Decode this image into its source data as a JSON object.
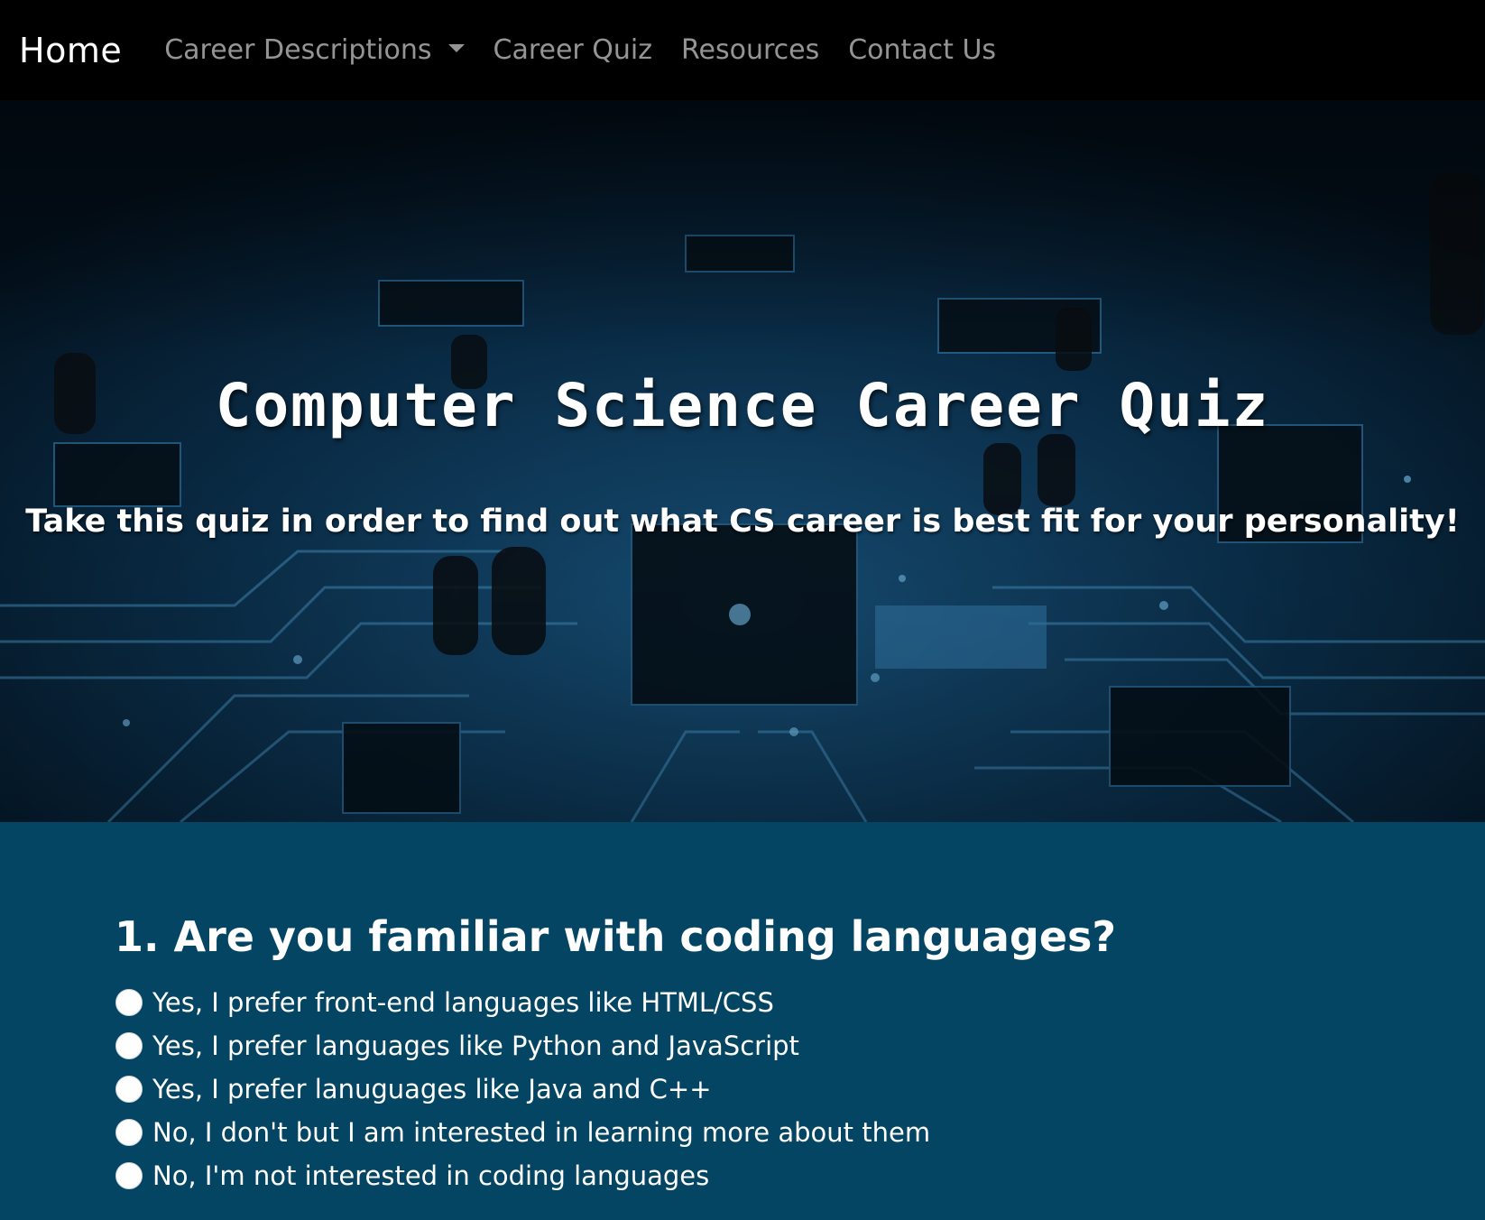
{
  "navbar": {
    "brand": "Home",
    "links": [
      {
        "label": "Career Descriptions",
        "dropdown": true
      },
      {
        "label": "Career Quiz"
      },
      {
        "label": "Resources"
      },
      {
        "label": "Contact Us"
      }
    ]
  },
  "hero": {
    "title": "Computer Science Career Quiz",
    "subtitle": "Take this quiz in order to find out what CS career is best fit for your personality!"
  },
  "quiz": {
    "question": "1. Are you familiar with coding languages?",
    "options": [
      "Yes, I prefer front-end languages like HTML/CSS",
      "Yes, I prefer languages like Python and JavaScript",
      "Yes, I prefer lanuguages like Java and C++",
      "No, I don't but I am interested in learning more about them",
      "No, I'm not interested in coding languages"
    ]
  },
  "colors": {
    "navbar_bg": "#000000",
    "quiz_bg": "#034562",
    "hero_accent": "#2a8fd6"
  }
}
